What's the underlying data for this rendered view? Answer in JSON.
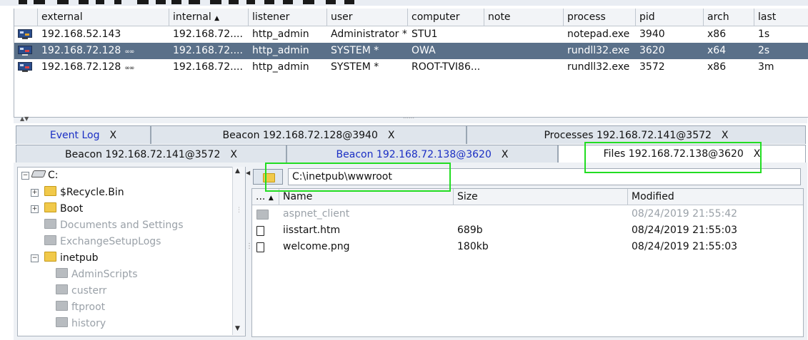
{
  "beacons": {
    "columns": [
      "external",
      "internal",
      "listener",
      "user",
      "computer",
      "note",
      "process",
      "pid",
      "arch",
      "last"
    ],
    "sort_indicator": "▲",
    "rows": [
      {
        "external": "192.168.52.143",
        "chain": "",
        "internal": "192.168.72....",
        "listener": "http_admin",
        "user": "Administrator *",
        "computer": "STU1",
        "note": "",
        "process": "notepad.exe",
        "pid": "3940",
        "arch": "x86",
        "last": "1s",
        "selected": false
      },
      {
        "external": "192.168.72.128",
        "chain": "∞∞",
        "internal": "192.168.72....",
        "listener": "http_admin",
        "user": "SYSTEM *",
        "computer": "OWA",
        "note": "",
        "process": "rundll32.exe",
        "pid": "3620",
        "arch": "x64",
        "last": "2s",
        "selected": true
      },
      {
        "external": "192.168.72.128",
        "chain": "∞∞",
        "internal": "192.168.72....",
        "listener": "http_admin",
        "user": "SYSTEM *",
        "computer": "ROOT-TVI86...",
        "note": "",
        "process": "rundll32.exe",
        "pid": "3572",
        "arch": "x86",
        "last": "3m",
        "selected": false
      }
    ]
  },
  "tabs": {
    "row1": [
      {
        "label": "Event Log",
        "color": "blue"
      },
      {
        "label": "Beacon 192.168.72.128@3940",
        "color": "black"
      },
      {
        "label": "Processes 192.168.72.141@3572",
        "color": "black"
      }
    ],
    "row2": [
      {
        "label": "Beacon 192.168.72.141@3572",
        "color": "black"
      },
      {
        "label": "Beacon 192.168.72.138@3620",
        "color": "blue"
      },
      {
        "label": "Files 192.168.72.138@3620",
        "color": "black",
        "active": true
      }
    ],
    "close_label": "X"
  },
  "tree": {
    "root": "C:",
    "items": [
      {
        "label": "$Recycle.Bin",
        "level": 1,
        "expander": "+",
        "dim": false
      },
      {
        "label": "Boot",
        "level": 1,
        "expander": "+",
        "dim": false
      },
      {
        "label": "Documents and Settings",
        "level": 1,
        "expander": "",
        "dim": true
      },
      {
        "label": "ExchangeSetupLogs",
        "level": 1,
        "expander": "",
        "dim": true
      },
      {
        "label": "inetpub",
        "level": 1,
        "expander": "−",
        "dim": false
      },
      {
        "label": "AdminScripts",
        "level": 2,
        "expander": "",
        "dim": true
      },
      {
        "label": "custerr",
        "level": 2,
        "expander": "",
        "dim": true
      },
      {
        "label": "ftproot",
        "level": 2,
        "expander": "",
        "dim": true
      },
      {
        "label": "history",
        "level": 2,
        "expander": "",
        "dim": true
      }
    ]
  },
  "path": {
    "value": "C:\\inetpub\\wwwroot"
  },
  "files": {
    "columns": [
      "...",
      "Name",
      "Size",
      "Modified"
    ],
    "rows": [
      {
        "type": "folder",
        "name": "aspnet_client",
        "size": "",
        "modified": "08/24/2019 21:55:42",
        "dim": true
      },
      {
        "type": "file",
        "name": "iisstart.htm",
        "size": "689b",
        "modified": "08/24/2019 21:55:03",
        "dim": false
      },
      {
        "type": "file",
        "name": "welcome.png",
        "size": "180kb",
        "modified": "08/24/2019 21:55:03",
        "dim": false
      }
    ]
  },
  "colors": {
    "selected_row": "#5a7089",
    "highlight": "#22dd22",
    "link_blue": "#1a2ec4"
  }
}
